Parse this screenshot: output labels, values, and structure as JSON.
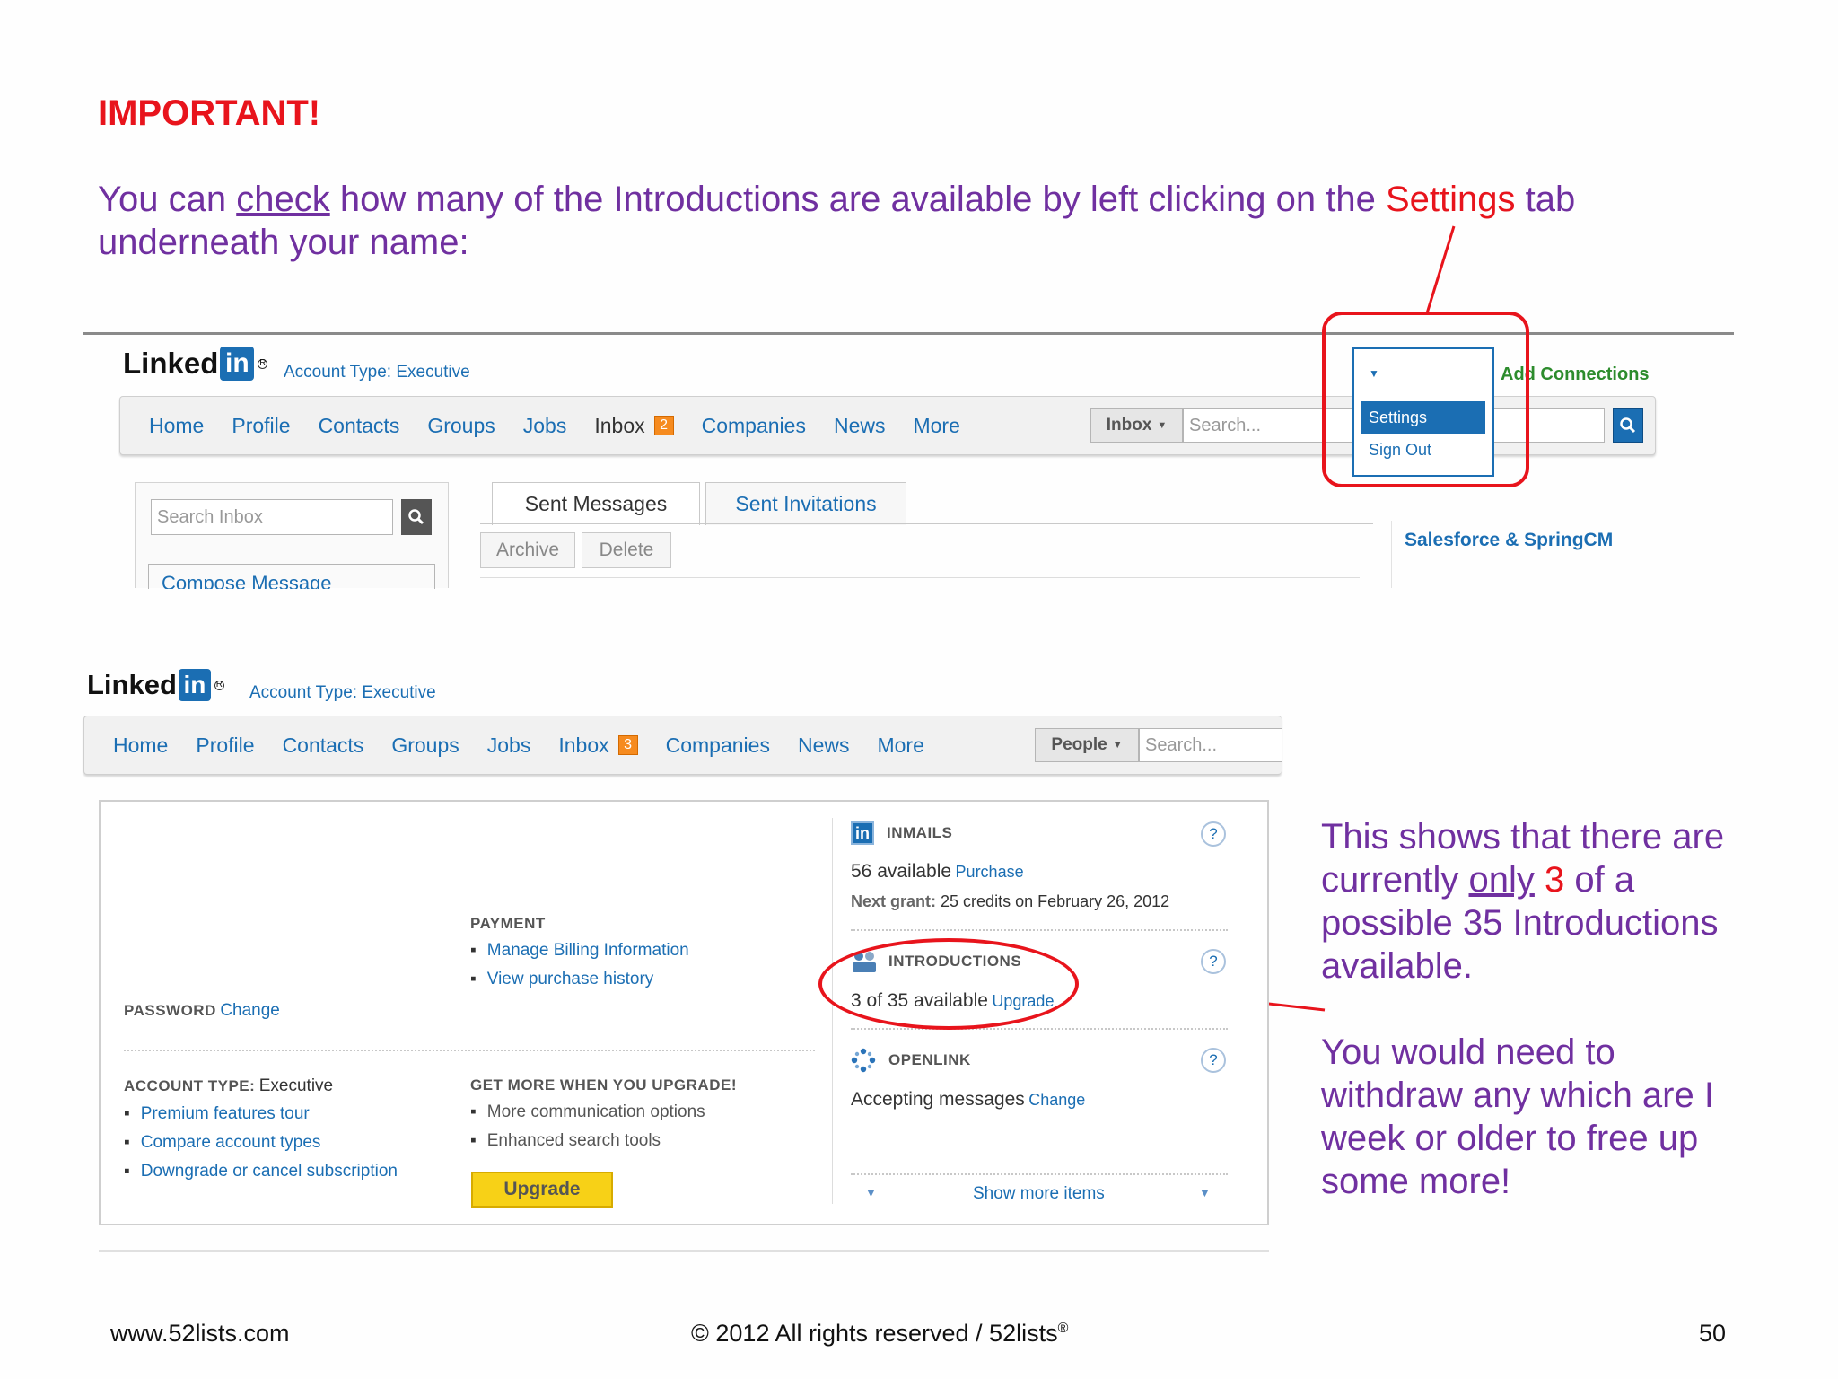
{
  "slide": {
    "heading": "IMPORTANT!",
    "intro": {
      "part1": "You can ",
      "check": "check",
      "part2": " how many of the Introductions are available by left clicking on the ",
      "settings": "Settings",
      "part3": " tab underneath your name:"
    },
    "note1": {
      "part1": "This shows that there are currently ",
      "only": "only",
      "space": " ",
      "three": "3",
      "part2": " of a possible 35 Introductions available."
    },
    "note2": "You would need to withdraw any which are I week or older to free up some more!",
    "footer": {
      "left": "www.52lists.com",
      "center": "© 2012 All rights reserved / 52lists",
      "reg": "®",
      "page": "50"
    }
  },
  "logo": {
    "word": "Linked",
    "in": "in",
    "reg": "R"
  },
  "shot1": {
    "account_type": "Account Type: Executive",
    "nav": [
      "Home",
      "Profile",
      "Contacts",
      "Groups",
      "Jobs",
      "Inbox",
      "Companies",
      "News",
      "More"
    ],
    "inbox_badge": "2",
    "scope": "Inbox",
    "search_placeholder": "Search...",
    "add_connections": "Add Connections",
    "dropdown": {
      "active": "Settings",
      "item": "Sign Out"
    },
    "search_inbox_placeholder": "Search Inbox",
    "compose": "Compose Message",
    "tabs": [
      "Sent Messages",
      "Sent Invitations"
    ],
    "buttons": [
      "Archive",
      "Delete"
    ],
    "sidebar_link": "Salesforce & SpringCM"
  },
  "shot2": {
    "account_type": "Account Type: Executive",
    "nav": [
      "Home",
      "Profile",
      "Contacts",
      "Groups",
      "Jobs",
      "Inbox",
      "Companies",
      "News",
      "More"
    ],
    "inbox_badge": "3",
    "scope": "People",
    "search_placeholder": "Search...",
    "password": {
      "label": "PASSWORD",
      "link": "Change"
    },
    "payment": {
      "label": "PAYMENT",
      "links": [
        "Manage Billing Information",
        "View purchase history"
      ]
    },
    "account": {
      "label": "ACCOUNT TYPE:",
      "value": "Executive",
      "links": [
        "Premium features tour",
        "Compare account types",
        "Downgrade or cancel subscription"
      ]
    },
    "upgrade": {
      "label": "GET MORE WHEN YOU UPGRADE!",
      "items": [
        "More communication options",
        "Enhanced search tools"
      ],
      "button": "Upgrade"
    },
    "inmails": {
      "label": "INMAILS",
      "available": "56 available",
      "purchase": "Purchase",
      "next_label": "Next grant:",
      "next_value": "25 credits on February 26, 2012"
    },
    "introductions": {
      "label": "INTRODUCTIONS",
      "available": "3 of 35 available",
      "upgrade": "Upgrade"
    },
    "openlink": {
      "label": "OPENLINK",
      "status": "Accepting messages",
      "change": "Change"
    },
    "help": "?",
    "show_more": "Show more items"
  },
  "colors": {
    "purple": "#7030a0",
    "red": "#e8141c",
    "linkedin_blue": "#1b6eb3",
    "badge_orange": "#f68b1f",
    "upgrade_yellow": "#f7d117"
  }
}
